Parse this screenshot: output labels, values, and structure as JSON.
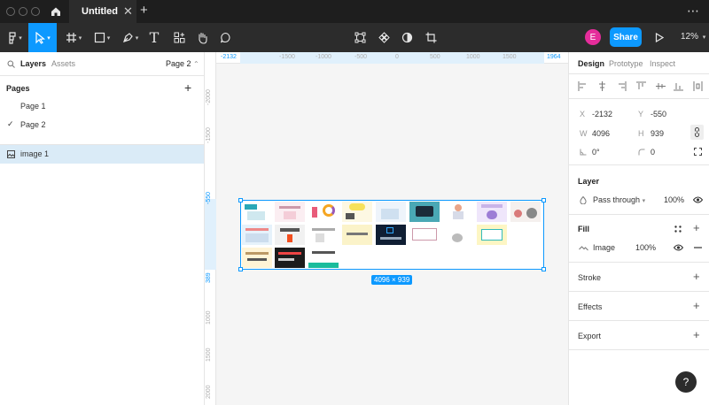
{
  "titlebar": {
    "tab_label": "Untitled",
    "close_glyph": "✕",
    "new_tab_glyph": "+",
    "more_glyph": "⋯"
  },
  "toolbar": {
    "caret": "▾",
    "text_tool": "T",
    "avatar_initial": "E",
    "share_label": "Share",
    "zoom": "12%"
  },
  "left_panel": {
    "tabs": [
      "Layers",
      "Assets"
    ],
    "current_page": "Page 2",
    "page_caret": "⌃",
    "pages_heading": "Pages",
    "add_glyph": "+",
    "pages": [
      "Page 1",
      "Page 2"
    ],
    "check_glyph": "✓",
    "layers": [
      "image 1"
    ]
  },
  "canvas": {
    "ruler_top": [
      "-2132",
      "-1500",
      "-1000",
      "-500",
      "0",
      "500",
      "1000",
      "1500",
      "1964"
    ],
    "ruler_left": [
      "-2000",
      "-1500",
      "-550",
      "389",
      "1000",
      "1500",
      "2000"
    ],
    "size_badge": "4096 × 939"
  },
  "right_panel": {
    "tabs": [
      "Design",
      "Prototype",
      "Inspect"
    ],
    "x_label": "X",
    "x_value": "-2132",
    "y_label": "Y",
    "y_value": "-550",
    "w_label": "W",
    "w_value": "4096",
    "h_label": "H",
    "h_value": "939",
    "rotation": "0°",
    "radius": "0",
    "layer_title": "Layer",
    "blend_mode": "Pass through",
    "layer_opacity": "100%",
    "fill_title": "Fill",
    "fill_type": "Image",
    "fill_opacity": "100%",
    "stroke_title": "Stroke",
    "effects_title": "Effects",
    "export_title": "Export",
    "plus_glyph": "+"
  },
  "help_label": "?",
  "colors": {
    "accent": "#0d99ff",
    "toolbar": "#2c2c2c",
    "titlebar": "#1e1e1e",
    "avatar": "#e52d9b"
  },
  "icons": [
    "home-icon",
    "figma-menu-icon",
    "move-tool-icon",
    "frame-tool-icon",
    "shape-tool-icon",
    "pen-tool-icon",
    "text-tool-icon",
    "resources-icon",
    "hand-tool-icon",
    "comment-icon",
    "edit-object-icon",
    "component-icon",
    "mask-icon",
    "crop-icon",
    "play-icon",
    "image-layer-icon",
    "eye-icon",
    "grid-dots-icon"
  ]
}
